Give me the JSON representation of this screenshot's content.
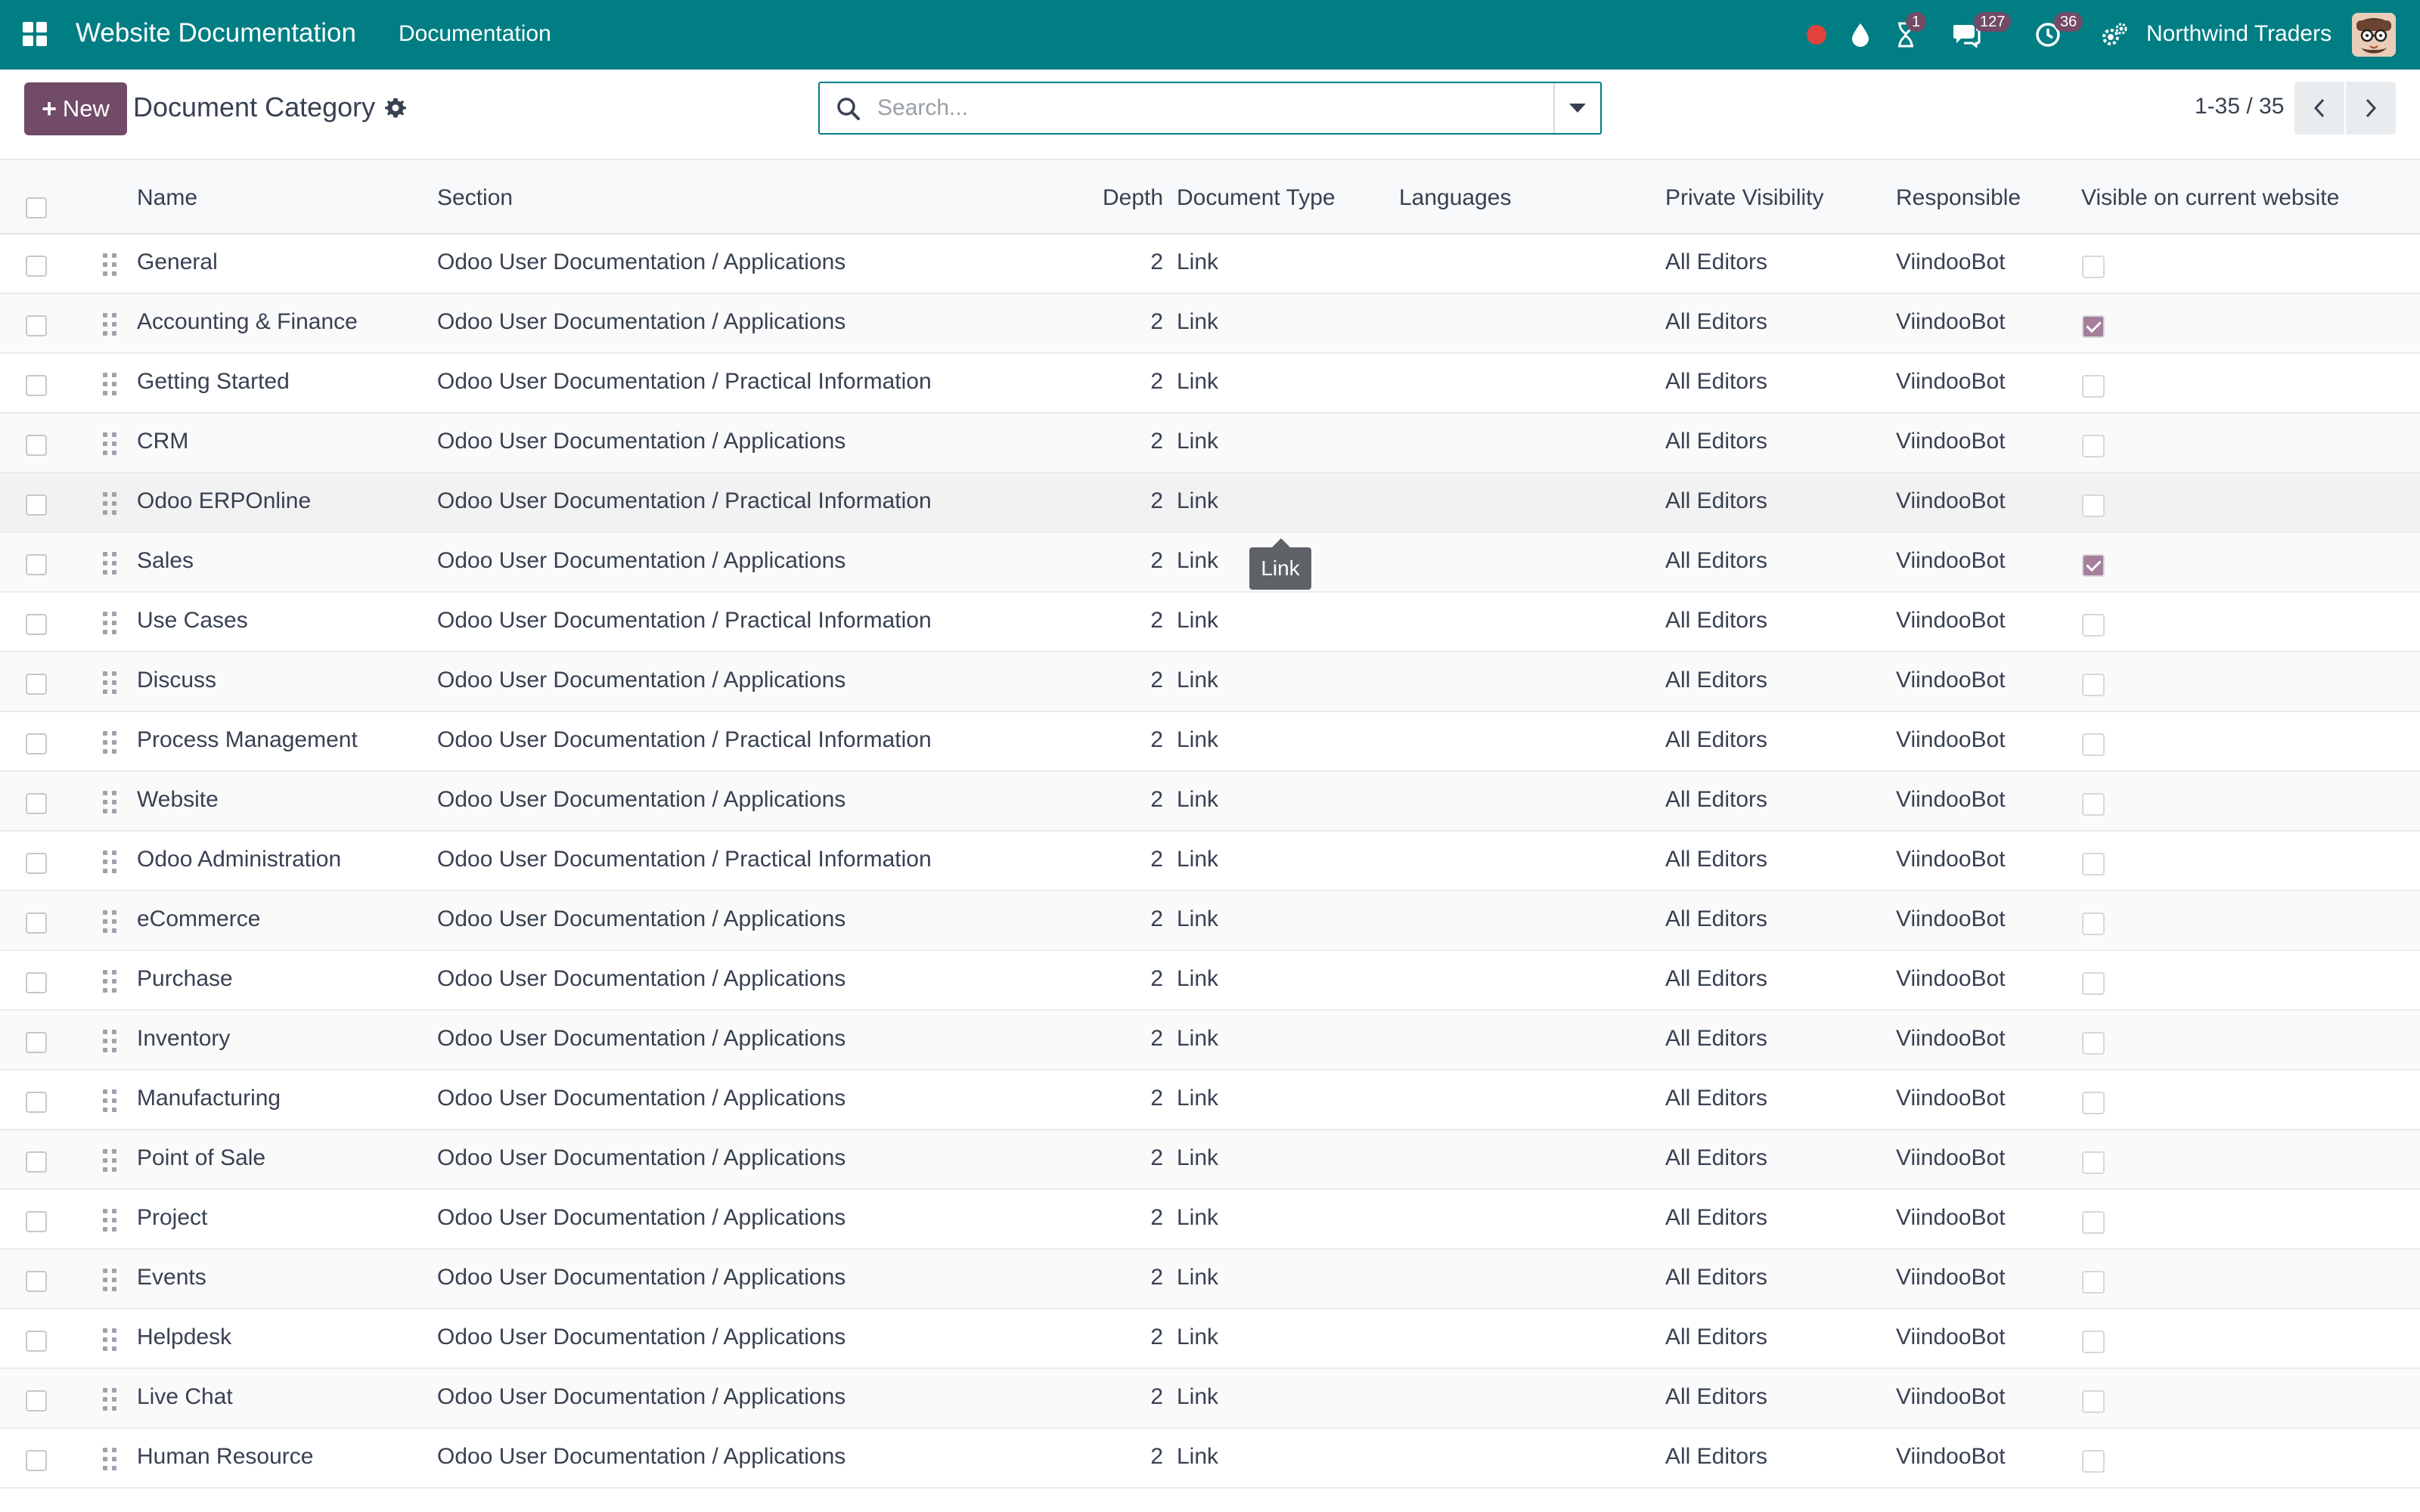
{
  "navbar": {
    "app_title": "Website Documentation",
    "menu_item": "Documentation",
    "icons": [
      "apps-grid-icon",
      "recording-dot-icon",
      "drop-icon",
      "hourglass-icon",
      "chat-icon",
      "clock-icon",
      "settings-icon"
    ],
    "badges": {
      "activity": "1",
      "messages": "127",
      "clock": "36"
    },
    "company": "Northwind Traders",
    "accent_color": "#017e84"
  },
  "control_panel": {
    "new_label": "New",
    "title": "Document Category",
    "search_placeholder": "Search...",
    "pager": "1-35 / 35",
    "button_color": "#714b67"
  },
  "table": {
    "headers": {
      "name": "Name",
      "section": "Section",
      "depth": "Depth",
      "document_type": "Document Type",
      "languages": "Languages",
      "private_visibility": "Private Visibility",
      "responsible": "Responsible",
      "visible": "Visible on current website"
    },
    "rows": [
      {
        "name": "General",
        "section": "Odoo User Documentation / Applications",
        "depth": "2",
        "type": "Link",
        "languages": "",
        "visibility": "All Editors",
        "responsible": "ViindooBot",
        "visible": false
      },
      {
        "name": "Accounting & Finance",
        "section": "Odoo User Documentation / Applications",
        "depth": "2",
        "type": "Link",
        "languages": "",
        "visibility": "All Editors",
        "responsible": "ViindooBot",
        "visible": true
      },
      {
        "name": "Getting Started",
        "section": "Odoo User Documentation / Practical Information",
        "depth": "2",
        "type": "Link",
        "languages": "",
        "visibility": "All Editors",
        "responsible": "ViindooBot",
        "visible": false
      },
      {
        "name": "CRM",
        "section": "Odoo User Documentation / Applications",
        "depth": "2",
        "type": "Link",
        "languages": "",
        "visibility": "All Editors",
        "responsible": "ViindooBot",
        "visible": false
      },
      {
        "name": "Odoo ERPOnline",
        "section": "Odoo User Documentation / Practical Information",
        "depth": "2",
        "type": "Link",
        "languages": "",
        "visibility": "All Editors",
        "responsible": "ViindooBot",
        "visible": false
      },
      {
        "name": "Sales",
        "section": "Odoo User Documentation / Applications",
        "depth": "2",
        "type": "Link",
        "languages": "",
        "visibility": "All Editors",
        "responsible": "ViindooBot",
        "visible": true
      },
      {
        "name": "Use Cases",
        "section": "Odoo User Documentation / Practical Information",
        "depth": "2",
        "type": "Link",
        "languages": "",
        "visibility": "All Editors",
        "responsible": "ViindooBot",
        "visible": false
      },
      {
        "name": "Discuss",
        "section": "Odoo User Documentation / Applications",
        "depth": "2",
        "type": "Link",
        "languages": "",
        "visibility": "All Editors",
        "responsible": "ViindooBot",
        "visible": false
      },
      {
        "name": "Process Management",
        "section": "Odoo User Documentation / Practical Information",
        "depth": "2",
        "type": "Link",
        "languages": "",
        "visibility": "All Editors",
        "responsible": "ViindooBot",
        "visible": false
      },
      {
        "name": "Website",
        "section": "Odoo User Documentation / Applications",
        "depth": "2",
        "type": "Link",
        "languages": "",
        "visibility": "All Editors",
        "responsible": "ViindooBot",
        "visible": false
      },
      {
        "name": "Odoo Administration",
        "section": "Odoo User Documentation / Practical Information",
        "depth": "2",
        "type": "Link",
        "languages": "",
        "visibility": "All Editors",
        "responsible": "ViindooBot",
        "visible": false
      },
      {
        "name": "eCommerce",
        "section": "Odoo User Documentation / Applications",
        "depth": "2",
        "type": "Link",
        "languages": "",
        "visibility": "All Editors",
        "responsible": "ViindooBot",
        "visible": false
      },
      {
        "name": "Purchase",
        "section": "Odoo User Documentation / Applications",
        "depth": "2",
        "type": "Link",
        "languages": "",
        "visibility": "All Editors",
        "responsible": "ViindooBot",
        "visible": false
      },
      {
        "name": "Inventory",
        "section": "Odoo User Documentation / Applications",
        "depth": "2",
        "type": "Link",
        "languages": "",
        "visibility": "All Editors",
        "responsible": "ViindooBot",
        "visible": false
      },
      {
        "name": "Manufacturing",
        "section": "Odoo User Documentation / Applications",
        "depth": "2",
        "type": "Link",
        "languages": "",
        "visibility": "All Editors",
        "responsible": "ViindooBot",
        "visible": false
      },
      {
        "name": "Point of Sale",
        "section": "Odoo User Documentation / Applications",
        "depth": "2",
        "type": "Link",
        "languages": "",
        "visibility": "All Editors",
        "responsible": "ViindooBot",
        "visible": false
      },
      {
        "name": "Project",
        "section": "Odoo User Documentation / Applications",
        "depth": "2",
        "type": "Link",
        "languages": "",
        "visibility": "All Editors",
        "responsible": "ViindooBot",
        "visible": false
      },
      {
        "name": "Events",
        "section": "Odoo User Documentation / Applications",
        "depth": "2",
        "type": "Link",
        "languages": "",
        "visibility": "All Editors",
        "responsible": "ViindooBot",
        "visible": false
      },
      {
        "name": "Helpdesk",
        "section": "Odoo User Documentation / Applications",
        "depth": "2",
        "type": "Link",
        "languages": "",
        "visibility": "All Editors",
        "responsible": "ViindooBot",
        "visible": false
      },
      {
        "name": "Live Chat",
        "section": "Odoo User Documentation / Applications",
        "depth": "2",
        "type": "Link",
        "languages": "",
        "visibility": "All Editors",
        "responsible": "ViindooBot",
        "visible": false
      },
      {
        "name": "Human Resource",
        "section": "Odoo User Documentation / Applications",
        "depth": "2",
        "type": "Link",
        "languages": "",
        "visibility": "All Editors",
        "responsible": "ViindooBot",
        "visible": false
      }
    ],
    "hover_row_index": 4,
    "check_color": "#a57f9c"
  },
  "tooltip": {
    "text": "Link"
  }
}
